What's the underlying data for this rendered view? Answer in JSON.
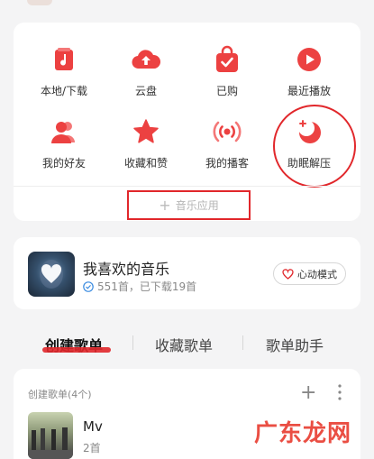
{
  "apps": [
    {
      "label": "本地/下载",
      "icon": "music-file-icon"
    },
    {
      "label": "云盘",
      "icon": "cloud-upload-icon"
    },
    {
      "label": "已购",
      "icon": "shopping-bag-icon"
    },
    {
      "label": "最近播放",
      "icon": "play-circle-icon"
    },
    {
      "label": "我的好友",
      "icon": "friends-icon"
    },
    {
      "label": "收藏和赞",
      "icon": "star-icon"
    },
    {
      "label": "我的播客",
      "icon": "podcast-icon"
    },
    {
      "label": "助眠解压",
      "icon": "moon-icon"
    }
  ],
  "music_apps_label": "音乐应用",
  "favorite": {
    "title": "我喜欢的音乐",
    "subtitle": "551首，已下载19首",
    "mode_button": "心动模式"
  },
  "tabs": [
    {
      "label": "创建歌单",
      "active": true
    },
    {
      "label": "收藏歌单",
      "active": false
    },
    {
      "label": "歌单助手",
      "active": false
    }
  ],
  "playlists": {
    "header": "创建歌单(4个)",
    "items": [
      {
        "name": "Mv",
        "count": "2首"
      }
    ]
  },
  "watermark": "广东龙网",
  "colors": {
    "accent": "#e1272b",
    "icon_red": "#ec4141"
  }
}
